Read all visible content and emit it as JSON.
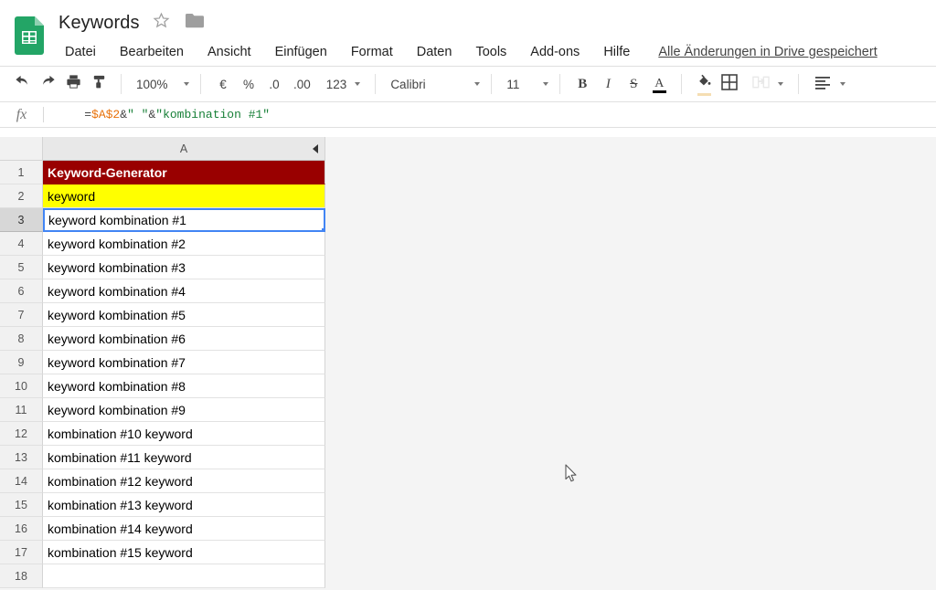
{
  "app": {
    "logo_icon": "google-sheets-icon",
    "doc_title": "Keywords",
    "star_icon": "star-outline-icon",
    "folder_icon": "folder-icon",
    "save_status": "Alle Änderungen in Drive gespeichert"
  },
  "menu": {
    "items": [
      {
        "label": "Datei"
      },
      {
        "label": "Bearbeiten"
      },
      {
        "label": "Ansicht"
      },
      {
        "label": "Einfügen"
      },
      {
        "label": "Format"
      },
      {
        "label": "Daten"
      },
      {
        "label": "Tools"
      },
      {
        "label": "Add-ons"
      },
      {
        "label": "Hilfe"
      }
    ]
  },
  "toolbar": {
    "undo_icon": "undo-icon",
    "redo_icon": "redo-icon",
    "print_icon": "print-icon",
    "paint_format_icon": "paint-format-icon",
    "zoom_value": "100%",
    "currency_label": "€",
    "percent_label": "%",
    "decrease_decimal_label": ".0",
    "increase_decimal_label": ".00",
    "more_formats_label": "123",
    "font_name": "Calibri",
    "font_size": "11",
    "bold_label": "B",
    "italic_label": "I",
    "strikethrough_label": "S",
    "text_color_label": "A",
    "text_color_hex": "#000000",
    "fill_color_icon": "fill-color-icon",
    "fill_color_hex": "#f5deb3",
    "borders_icon": "borders-icon",
    "merge_cells_icon": "merge-cells-icon",
    "align_icon": "align-left-icon"
  },
  "formula_bar": {
    "fx_label": "fx",
    "value": "=$A$2&\" \"&\"kombination #1\"",
    "tokens": [
      {
        "text": "=",
        "type": "op"
      },
      {
        "text": "$A$2",
        "type": "ref"
      },
      {
        "text": "&",
        "type": "op"
      },
      {
        "text": "\" \"",
        "type": "str"
      },
      {
        "text": "&",
        "type": "op"
      },
      {
        "text": "\"kombination #1\"",
        "type": "str"
      }
    ]
  },
  "grid": {
    "column_header": "A",
    "collapse_icon": "collapse-group-left-icon",
    "selected_cell": "A3",
    "rows": [
      {
        "num": "1",
        "value": "Keyword-Generator",
        "style": "header-red"
      },
      {
        "num": "2",
        "value": "keyword",
        "style": "yellow"
      },
      {
        "num": "3",
        "value": "keyword kombination #1",
        "style": "selected"
      },
      {
        "num": "4",
        "value": "keyword kombination #2",
        "style": ""
      },
      {
        "num": "5",
        "value": "keyword kombination #3",
        "style": ""
      },
      {
        "num": "6",
        "value": "keyword kombination #4",
        "style": ""
      },
      {
        "num": "7",
        "value": "keyword kombination #5",
        "style": ""
      },
      {
        "num": "8",
        "value": "keyword kombination #6",
        "style": ""
      },
      {
        "num": "9",
        "value": "keyword kombination #7",
        "style": ""
      },
      {
        "num": "10",
        "value": "keyword kombination #8",
        "style": ""
      },
      {
        "num": "11",
        "value": "keyword kombination #9",
        "style": ""
      },
      {
        "num": "12",
        "value": "kombination #10 keyword",
        "style": ""
      },
      {
        "num": "13",
        "value": "kombination #11 keyword",
        "style": ""
      },
      {
        "num": "14",
        "value": "kombination #12 keyword",
        "style": ""
      },
      {
        "num": "15",
        "value": "kombination #13 keyword",
        "style": ""
      },
      {
        "num": "16",
        "value": "kombination #14 keyword",
        "style": ""
      },
      {
        "num": "17",
        "value": "kombination #15 keyword",
        "style": ""
      },
      {
        "num": "18",
        "value": "",
        "style": ""
      }
    ]
  },
  "colors": {
    "header_red": "#990000",
    "highlight_yellow": "#ffff00",
    "selection_blue": "#4285f4",
    "sheets_green": "#23a566"
  },
  "cursor": {
    "icon": "mouse-pointer-icon"
  }
}
